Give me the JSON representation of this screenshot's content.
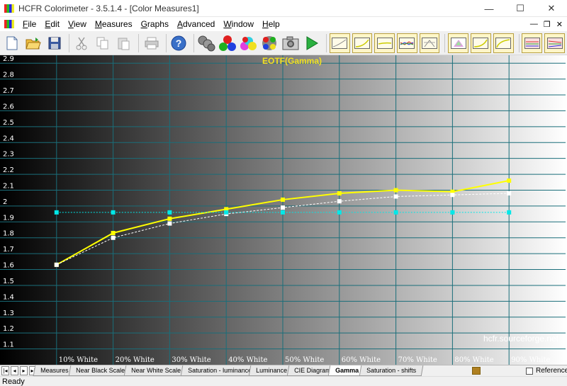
{
  "window": {
    "title": "HCFR Colorimeter - 3.5.1.4 - [Color Measures1]",
    "controls": {
      "minimize": "—",
      "maximize": "☐",
      "close": "✕"
    }
  },
  "menu": [
    "File",
    "Edit",
    "View",
    "Measures",
    "Graphs",
    "Advanced",
    "Window",
    "Help"
  ],
  "mdi_controls": {
    "minimize": "—",
    "restore": "❐",
    "close": "✕"
  },
  "toolbar": {
    "buttons": [
      "new-file-icon",
      "open-folder-icon",
      "save-disk-icon",
      "cut-icon",
      "copy-icon",
      "paste-icon",
      "print-icon",
      "help-icon",
      "probe-icon",
      "rgb-balls-icon",
      "color-balls-icon",
      "multi-color-icon",
      "camera-icon",
      "play-icon"
    ],
    "graph_buttons": [
      "luminance-view",
      "gamma-view",
      "rgb-levels-view",
      "color-temp-view",
      "cie-view",
      "saturation-view",
      "luminance-graph",
      "contrast-graph",
      "near-black-graph",
      "near-white-graph"
    ]
  },
  "chart_data": {
    "type": "line",
    "title": "EOTF(Gamma)",
    "categories": [
      "",
      "10% White",
      "20% White",
      "30% White",
      "40% White",
      "50% White",
      "60% White",
      "70% White",
      "80% White",
      "90% White"
    ],
    "xlim": [
      0,
      10
    ],
    "ylim": [
      1.0,
      2.95
    ],
    "y_ticks": [
      1.1,
      1.2,
      1.3,
      1.4,
      1.5,
      1.6,
      1.7,
      1.8,
      1.9,
      2,
      2.1,
      2.2,
      2.3,
      2.4,
      2.5,
      2.6,
      2.7,
      2.8,
      2.9
    ],
    "grid": true,
    "series": [
      {
        "values": [
          1.63,
          1.83,
          1.92,
          1.98,
          2.04,
          2.08,
          2.1,
          2.09,
          2.16
        ],
        "color": "#ffff00",
        "style": "solid"
      },
      {
        "values": [
          1.63,
          1.8,
          1.89,
          1.95,
          1.99,
          2.03,
          2.06,
          2.07,
          2.08
        ],
        "color": "#ffffff",
        "style": "dashed"
      },
      {
        "values": [
          1.96,
          1.96,
          1.96,
          1.96,
          1.96,
          1.96,
          1.96,
          1.96,
          1.96
        ],
        "color": "#00e8e8",
        "style": "dotted"
      }
    ],
    "watermark": "hcfr.sourceforge.net"
  },
  "tabs": {
    "items": [
      "Measures",
      "Near Black Scale",
      "Near White Scale",
      "Saturation - luminance",
      "Luminance",
      "CIE Diagram",
      "Gamma",
      "Saturation - shifts"
    ],
    "active": "Gamma",
    "nav": [
      "|◂",
      "◂",
      "▸",
      "▸|"
    ],
    "reference_label": "Reference"
  },
  "status": "Ready"
}
